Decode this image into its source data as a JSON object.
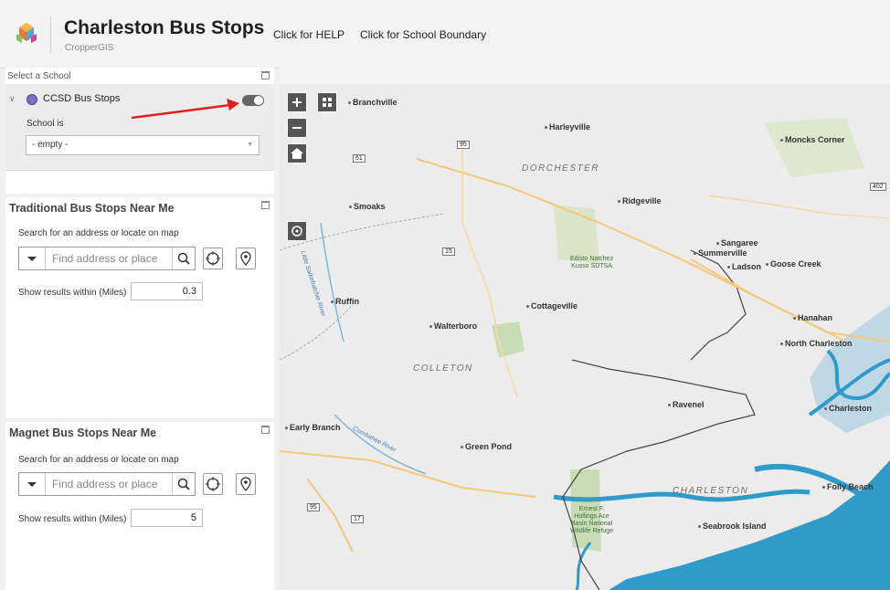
{
  "header": {
    "title": "Charleston Bus Stops",
    "subtitle": "CropperGIS",
    "links": [
      "Click for HELP",
      "Click for School Boundary"
    ]
  },
  "filter_panel": {
    "caption": "Select a School",
    "layer_name": "CCSD Bus Stops",
    "toggle_on": false,
    "field_label": "School is",
    "select_value": "- empty -"
  },
  "traditional": {
    "title": "Traditional Bus Stops Near Me",
    "search_caption": "Search for an address or locate on map",
    "search_placeholder": "Find address or place",
    "radius_label": "Show results within (Miles)",
    "radius_value": "0.3"
  },
  "magnet": {
    "title": "Magnet Bus Stops Near Me",
    "search_caption": "Search for an address or locate on map",
    "search_placeholder": "Find address or place",
    "radius_label": "Show results within (Miles)",
    "radius_value": "5"
  },
  "map": {
    "places": [
      "Branchville",
      "Harleyville",
      "Moncks Corner",
      "Ridgeville",
      "Smoaks",
      "Sangaree",
      "Summerville",
      "Ladson",
      "Goose Creek",
      "Ruffin",
      "Cottageville",
      "Walterboro",
      "Hanahan",
      "North Charleston",
      "Ravenel",
      "Charleston",
      "Early Branch",
      "Green Pond",
      "Folly Beach",
      "Seabrook Island"
    ],
    "counties": [
      "DORCHESTER",
      "COLLETON",
      "CHARLESTON"
    ],
    "parks": [
      "Edisto Natchez\nKusso SDTSA",
      "Ernest F.\nHollings Ace\nBasin National\nWildlife Refuge"
    ],
    "shields": [
      "95",
      "61",
      "15",
      "402",
      "95",
      "17"
    ],
    "rivers": [
      "Little Salkehatchie River",
      "Combahee River"
    ],
    "icons": [
      "zoom-in-icon",
      "zoom-out-icon",
      "home-icon",
      "basemap-gallery-icon",
      "locate-icon"
    ]
  },
  "colors": {
    "header_bg": "#f3f3f3",
    "water": "#2f9bc8",
    "land": "#ececec",
    "toggle_off": "#666666"
  }
}
